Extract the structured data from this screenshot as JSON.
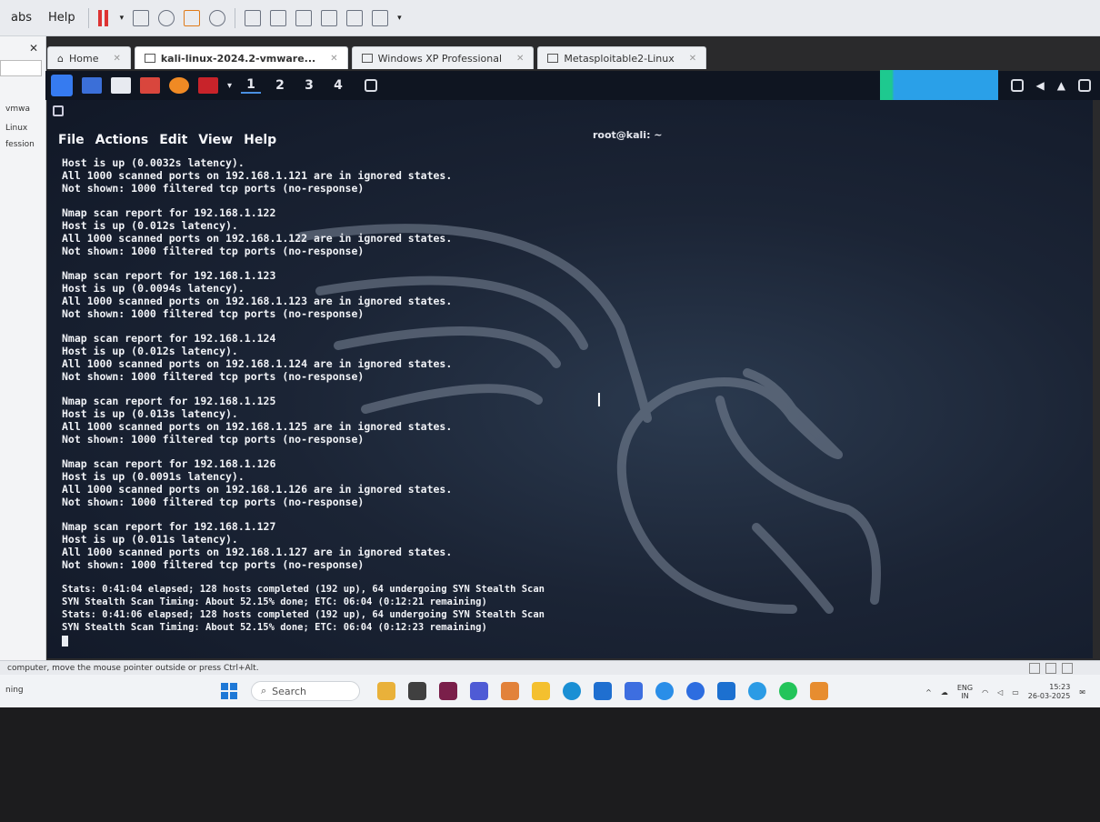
{
  "vm_menubar": {
    "items": [
      "abs",
      "Help"
    ]
  },
  "sidebar": {
    "items": [
      "vmwa",
      "Linux",
      "fession"
    ]
  },
  "tabs": [
    {
      "label": "Home",
      "active": false
    },
    {
      "label": "kali-linux-2024.2-vmware...",
      "active": true
    },
    {
      "label": "Windows XP Professional",
      "active": false
    },
    {
      "label": "Metasploitable2-Linux",
      "active": false
    }
  ],
  "kali_panel": {
    "workspaces": [
      "1",
      "2",
      "3",
      "4"
    ]
  },
  "terminal": {
    "title": "root@kali: ~",
    "menu": [
      "File",
      "Actions",
      "Edit",
      "View",
      "Help"
    ],
    "lines": [
      "Host is up (0.0032s latency).",
      "All 1000 scanned ports on 192.168.1.121 are in ignored states.",
      "Not shown: 1000 filtered tcp ports (no-response)",
      "",
      "Nmap scan report for 192.168.1.122",
      "Host is up (0.012s latency).",
      "All 1000 scanned ports on 192.168.1.122 are in ignored states.",
      "Not shown: 1000 filtered tcp ports (no-response)",
      "",
      "Nmap scan report for 192.168.1.123",
      "Host is up (0.0094s latency).",
      "All 1000 scanned ports on 192.168.1.123 are in ignored states.",
      "Not shown: 1000 filtered tcp ports (no-response)",
      "",
      "Nmap scan report for 192.168.1.124",
      "Host is up (0.012s latency).",
      "All 1000 scanned ports on 192.168.1.124 are in ignored states.",
      "Not shown: 1000 filtered tcp ports (no-response)",
      "",
      "Nmap scan report for 192.168.1.125",
      "Host is up (0.013s latency).",
      "All 1000 scanned ports on 192.168.1.125 are in ignored states.",
      "Not shown: 1000 filtered tcp ports (no-response)",
      "",
      "Nmap scan report for 192.168.1.126",
      "Host is up (0.0091s latency).",
      "All 1000 scanned ports on 192.168.1.126 are in ignored states.",
      "Not shown: 1000 filtered tcp ports (no-response)",
      "",
      "Nmap scan report for 192.168.1.127",
      "Host is up (0.011s latency).",
      "All 1000 scanned ports on 192.168.1.127 are in ignored states.",
      "Not shown: 1000 filtered tcp ports (no-response)",
      "",
      "Stats: 0:41:04 elapsed; 128 hosts completed (192 up), 64 undergoing SYN Stealth Scan",
      "SYN Stealth Scan Timing: About 52.15% done; ETC: 06:04 (0:12:21 remaining)",
      "Stats: 0:41:06 elapsed; 128 hosts completed (192 up), 64 undergoing SYN Stealth Scan",
      "SYN Stealth Scan Timing: About 52.15% done; ETC: 06:04 (0:12:23 remaining)"
    ]
  },
  "vm_status": {
    "text": "computer, move the mouse pointer outside or press Ctrl+Alt."
  },
  "taskbar": {
    "left_text": "ning",
    "search_placeholder": "Search",
    "lang_top": "ENG",
    "lang_bottom": "IN",
    "time": "15:23",
    "date": "26-03-2025"
  },
  "colors": {
    "kali_blue": "#367bf0",
    "terminal_bg": "#1b2435",
    "taskbar_bg": "#f1f3f6"
  }
}
